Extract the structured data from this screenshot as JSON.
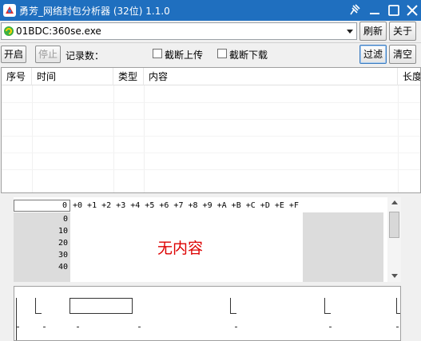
{
  "window": {
    "title": "勇芳_网络封包分析器 (32位) 1.1.0",
    "controls": [
      "pin-icon",
      "minimize-icon",
      "maximize-icon",
      "close-icon"
    ],
    "accent_color": "#1f6fbf"
  },
  "process": {
    "selected": "01BDC:360se.exe",
    "icon": "process-icon",
    "refresh_label": "刷新",
    "about_label": "关于"
  },
  "toolbar": {
    "start_label": "开启",
    "stop_label": "停止",
    "record_count_label": "记录数：",
    "truncate_upload_label": "截断上传",
    "truncate_download_label": "截断下载",
    "filter_label": "过滤",
    "clear_label": "清空"
  },
  "packet_list": {
    "columns": [
      "序号",
      "时间",
      "类型",
      "内容",
      "长度"
    ]
  },
  "hex_view": {
    "offset": "0",
    "header": "+0 +1 +2 +3 +4 +5 +6 +7 +8 +9 +A +B +C +D +E +F",
    "addresses": [
      "0",
      "10",
      "20",
      "30",
      "40"
    ],
    "empty_message": "无内容",
    "empty_color": "#dd0000"
  }
}
